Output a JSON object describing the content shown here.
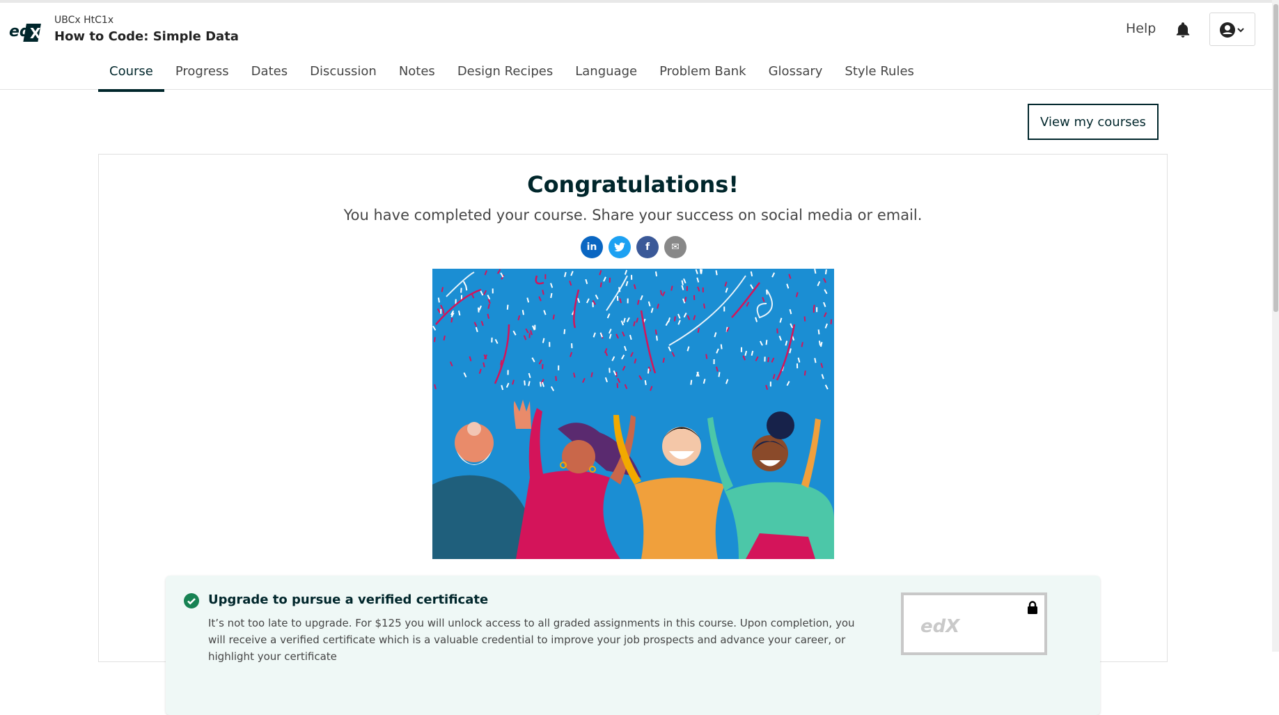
{
  "header": {
    "logo_text": "edX",
    "course_org": "UBCx HtC1x",
    "course_title": "How to Code: Simple Data",
    "help_label": "Help"
  },
  "tabs": [
    {
      "label": "Course",
      "active": true
    },
    {
      "label": "Progress"
    },
    {
      "label": "Dates"
    },
    {
      "label": "Discussion"
    },
    {
      "label": "Notes"
    },
    {
      "label": "Design Recipes"
    },
    {
      "label": "Language"
    },
    {
      "label": "Problem Bank"
    },
    {
      "label": "Glossary"
    },
    {
      "label": "Style Rules"
    }
  ],
  "actions": {
    "view_courses_label": "View my courses"
  },
  "celebration": {
    "title": "Congratulations!",
    "subtitle": "You have completed your course. Share your success on social media or email.",
    "share_buttons": [
      {
        "icon": "linkedin-icon",
        "glyph": "in",
        "color": "#0a66c2"
      },
      {
        "icon": "twitter-icon",
        "glyph": "t",
        "color": "#1da1f2"
      },
      {
        "icon": "facebook-icon",
        "glyph": "f",
        "color": "#3b5998"
      },
      {
        "icon": "email-icon",
        "glyph": "✉",
        "color": "#888888"
      }
    ]
  },
  "upgrade": {
    "title": "Upgrade to pursue a verified certificate",
    "text": "It’s not too late to upgrade. For $125 you will unlock access to all graded assignments in this course. Upon completion, you will receive a verified certificate which is a valuable credential to improve your job prospects and advance your career, or highlight your certificate"
  },
  "colors": {
    "brand_dark": "#00262b",
    "success_green": "#178253",
    "illustration_bg": "#1b8ed3"
  }
}
